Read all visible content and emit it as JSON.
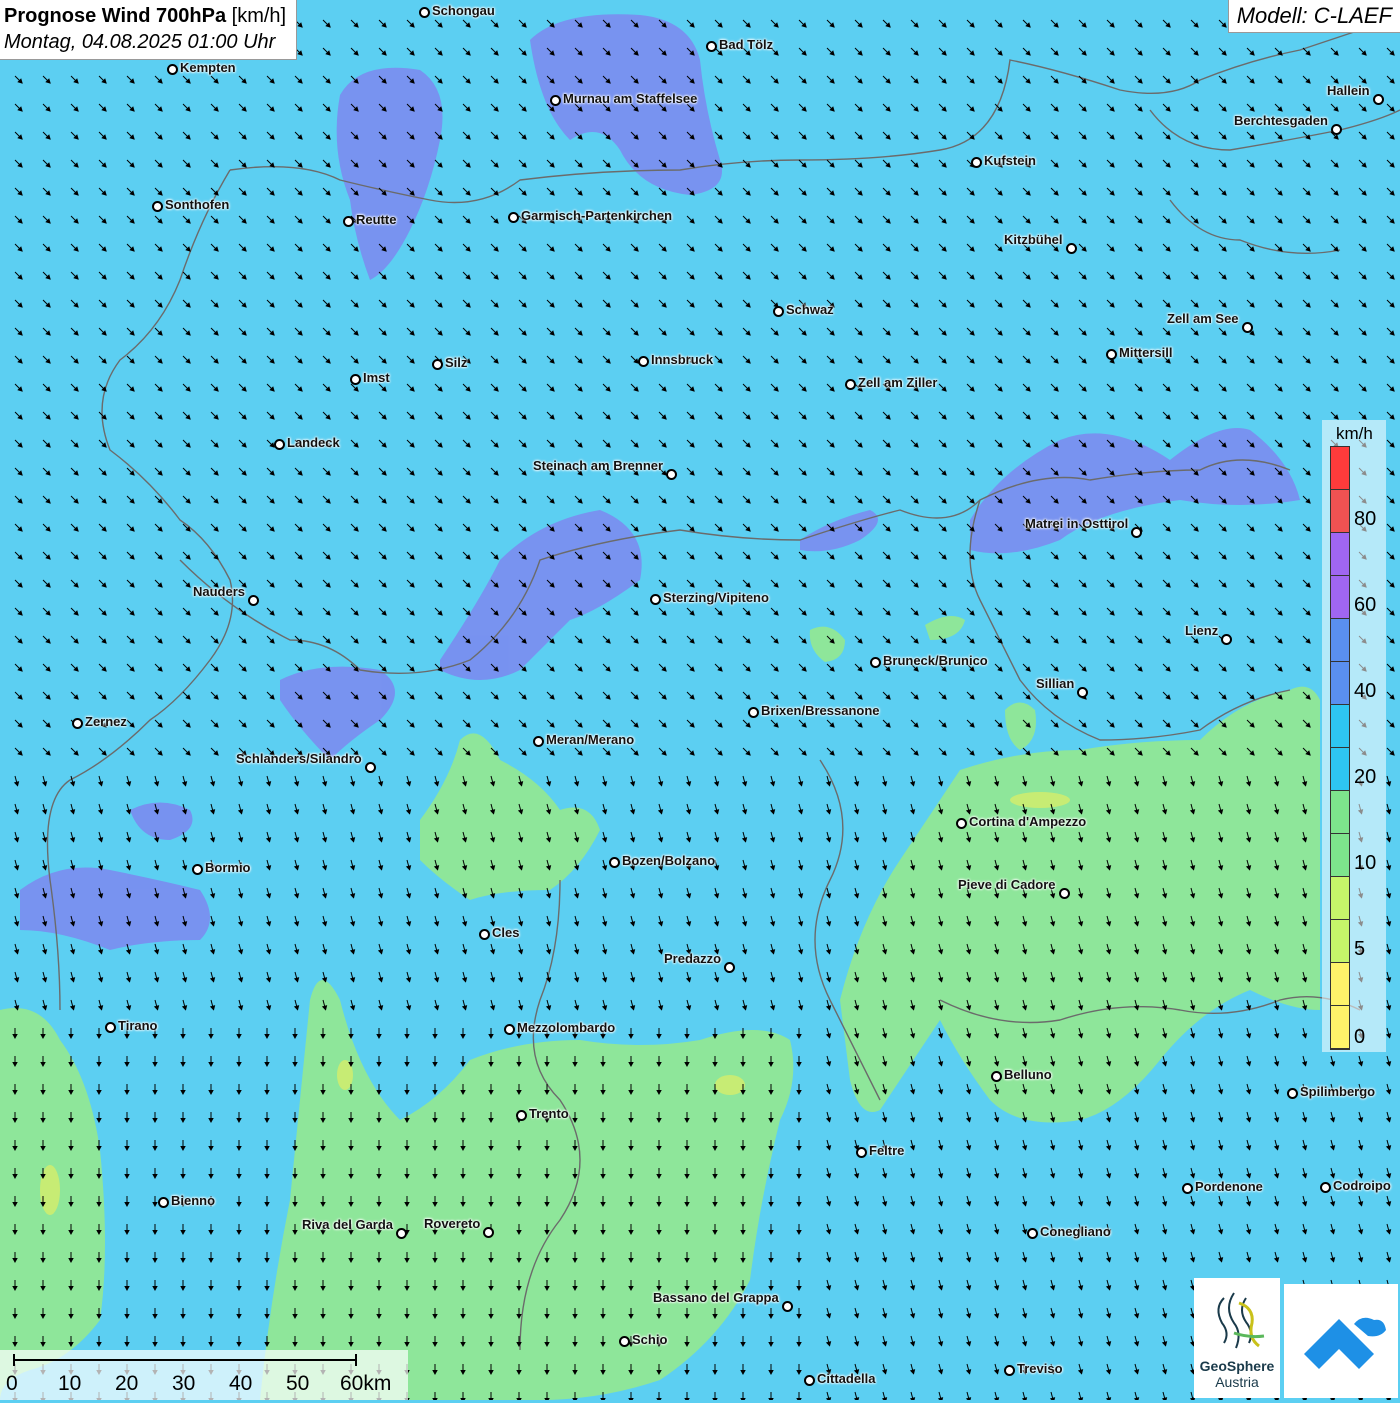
{
  "header": {
    "title_bold": "Prognose Wind 700hPa",
    "title_unit": "[km/h]",
    "datetime": "Montag, 04.08.2025 01:00 Uhr",
    "model": "Modell: C-LAEF"
  },
  "legend": {
    "unit": "km/h",
    "ticks": [
      "80",
      "60",
      "40",
      "20",
      "10",
      "5",
      "0"
    ],
    "colors": [
      "#ff3b3b",
      "#f05252",
      "#a066f2",
      "#a066f2",
      "#5a8ff0",
      "#5a8ff0",
      "#2ec5f2",
      "#2ec5f2",
      "#7de48c",
      "#7de48c",
      "#c6f56a",
      "#c6f56a",
      "#fff36a",
      "#fff36a"
    ]
  },
  "scale_bar": {
    "labels": [
      "0",
      "10",
      "20",
      "30",
      "40",
      "50",
      "60km"
    ]
  },
  "logos": {
    "geosphere_line1": "GeoSphere",
    "geosphere_line2": "Austria"
  },
  "cities": [
    {
      "name": "Schongau"
    },
    {
      "name": "Bad Tölz"
    },
    {
      "name": "Kempten"
    },
    {
      "name": "Murnau am Staffelsee"
    },
    {
      "name": "Hallein"
    },
    {
      "name": "Berchtesgaden"
    },
    {
      "name": "Kufstein"
    },
    {
      "name": "Sonthofen"
    },
    {
      "name": "Reutte"
    },
    {
      "name": "Garmisch-Partenkirchen"
    },
    {
      "name": "Kitzbühel"
    },
    {
      "name": "Schwaz"
    },
    {
      "name": "Zell am See"
    },
    {
      "name": "Mittersill"
    },
    {
      "name": "Innsbruck"
    },
    {
      "name": "Silz"
    },
    {
      "name": "Imst"
    },
    {
      "name": "Zell am Ziller"
    },
    {
      "name": "Landeck"
    },
    {
      "name": "Steinach am Brenner"
    },
    {
      "name": "Matrei in Osttirol"
    },
    {
      "name": "Nauders"
    },
    {
      "name": "Sterzing/Vipiteno"
    },
    {
      "name": "Lienz"
    },
    {
      "name": "Bruneck/Brunico"
    },
    {
      "name": "Sillian"
    },
    {
      "name": "Zernez"
    },
    {
      "name": "Brixen/Bressanone"
    },
    {
      "name": "Meran/Merano"
    },
    {
      "name": "Schlanders/Silandro"
    },
    {
      "name": "Cortina d'Ampezzo"
    },
    {
      "name": "Bozen/Bolzano"
    },
    {
      "name": "Bormio"
    },
    {
      "name": "Pieve di Cadore"
    },
    {
      "name": "Cles"
    },
    {
      "name": "Predazzo"
    },
    {
      "name": "Tirano"
    },
    {
      "name": "Mezzolombardo"
    },
    {
      "name": "Belluno"
    },
    {
      "name": "Spilimbergo"
    },
    {
      "name": "Trento"
    },
    {
      "name": "Feltre"
    },
    {
      "name": "Bienno"
    },
    {
      "name": "Pordenone"
    },
    {
      "name": "Codroipo"
    },
    {
      "name": "Riva del Garda"
    },
    {
      "name": "Rovereto"
    },
    {
      "name": "Conegliano"
    },
    {
      "name": "Bassano del Grappa"
    },
    {
      "name": "Schio"
    },
    {
      "name": "Treviso"
    },
    {
      "name": "Cittadella"
    }
  ]
}
